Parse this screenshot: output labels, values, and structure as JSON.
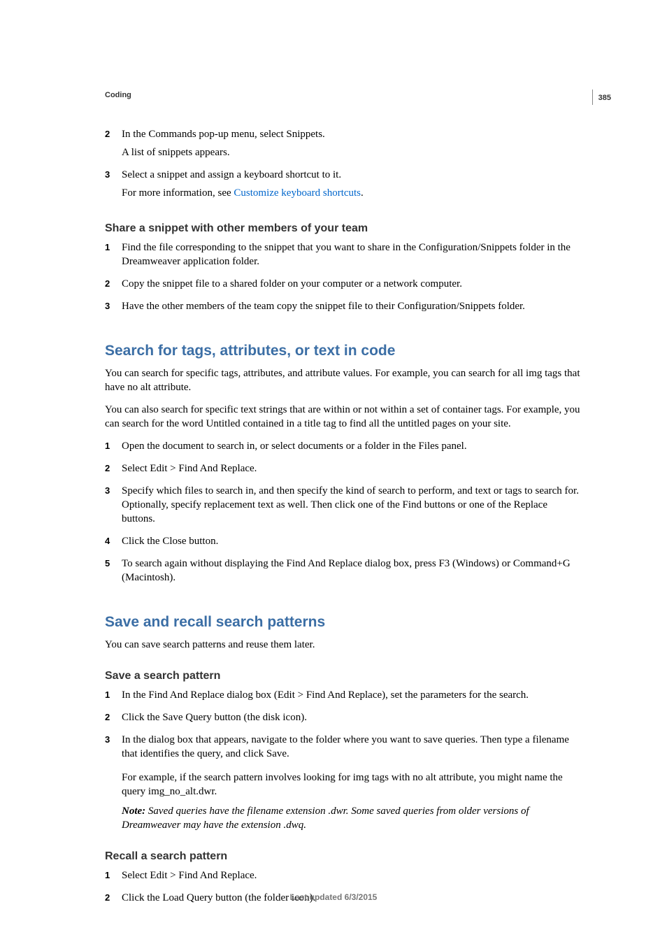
{
  "page_number": "385",
  "breadcrumb": "Coding",
  "intro_list": [
    {
      "n": "2",
      "paras": [
        "In the Commands pop-up menu, select Snippets.",
        "A list of snippets appears."
      ]
    },
    {
      "n": "3",
      "paras": [
        "Select a snippet and assign a keyboard shortcut to it.",
        "For more information, see "
      ]
    }
  ],
  "intro_link": "Customize keyboard shortcuts",
  "intro_link_after": ".",
  "share": {
    "heading": "Share a snippet with other members of your team",
    "items": [
      {
        "n": "1",
        "text": "Find the file corresponding to the snippet that you want to share in the Configuration/Snippets folder in the Dreamweaver application folder."
      },
      {
        "n": "2",
        "text": "Copy the snippet file to a shared folder on your computer or a network computer."
      },
      {
        "n": "3",
        "text": "Have the other members of the team copy the snippet file to their Configuration/Snippets folder."
      }
    ]
  },
  "search": {
    "heading": "Search for tags, attributes, or text in code",
    "p1": "You can search for specific tags, attributes, and attribute values. For example, you can search for all img tags that have no alt attribute.",
    "p2": "You can also search for specific text strings that are within or not within a set of container tags. For example, you can search for the word Untitled contained in a title tag to find all the untitled pages on your site.",
    "items": [
      {
        "n": "1",
        "text": "Open the document to search in, or select documents or a folder in the Files panel."
      },
      {
        "n": "2",
        "text": "Select Edit > Find And Replace."
      },
      {
        "n": "3",
        "text": "Specify which files to search in, and then specify the kind of search to perform, and text or tags to search for. Optionally, specify replacement text as well. Then click one of the Find buttons or one of the Replace buttons."
      },
      {
        "n": "4",
        "text": "Click the Close button."
      },
      {
        "n": "5",
        "text": "To search again without displaying the Find And Replace dialog box, press F3 (Windows) or Command+G (Macintosh)."
      }
    ]
  },
  "save_recall": {
    "heading": "Save and recall search patterns",
    "intro": "You can save search patterns and reuse them later."
  },
  "save_pattern": {
    "heading": "Save a search pattern",
    "items": [
      {
        "n": "1",
        "text": "In the Find And Replace dialog box (Edit > Find And Replace), set the parameters for the search."
      },
      {
        "n": "2",
        "text": "Click the Save Query button (the disk icon)."
      },
      {
        "n": "3",
        "text": "In the dialog box that appears, navigate to the folder where you want to save queries. Then type a filename that identifies the query, and click Save."
      }
    ],
    "example": "For example, if the search pattern involves looking for img tags with no alt attribute, you might name the query img_no_alt.dwr.",
    "note_label": "Note: ",
    "note_body": "Saved queries have the filename extension .dwr. Some saved queries from older versions of Dreamweaver may have the extension .dwq."
  },
  "recall_pattern": {
    "heading": "Recall a search pattern",
    "items": [
      {
        "n": "1",
        "text": "Select Edit > Find And Replace."
      },
      {
        "n": "2",
        "text": "Click the Load Query button (the folder icon)."
      }
    ]
  },
  "footer": "Last updated 6/3/2015"
}
